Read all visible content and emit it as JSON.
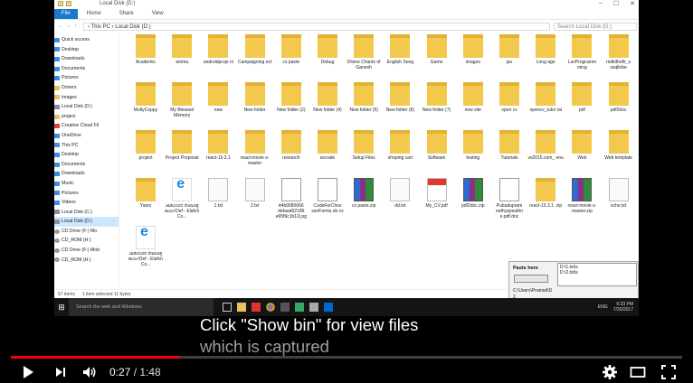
{
  "explorer": {
    "title": "Local Disk (D:)",
    "window_controls": [
      "–",
      "☐",
      "✕"
    ],
    "ribbon_tabs": [
      "File",
      "Home",
      "Share",
      "View"
    ],
    "address": "›  This PC  ›  Local Disk (D:)",
    "search_placeholder": "Search Local Disk (D:)",
    "nav_items": [
      {
        "label": "Quick access",
        "icon": "star-icon"
      },
      {
        "label": "Desktop",
        "icon": "desktop-icon"
      },
      {
        "label": "Downloads",
        "icon": "download-icon"
      },
      {
        "label": "Documents",
        "icon": "documents-icon"
      },
      {
        "label": "Pictures",
        "icon": "pictures-icon"
      },
      {
        "label": "Drivers",
        "icon": "folder-icon"
      },
      {
        "label": "images",
        "icon": "folder-icon"
      },
      {
        "label": "Local Disk (D:)",
        "icon": "drive-icon"
      },
      {
        "label": "project",
        "icon": "folder-icon"
      },
      {
        "label": "Creative Cloud Fil",
        "icon": "creative-cloud-icon"
      },
      {
        "label": "OneDrive",
        "icon": "onedrive-icon"
      },
      {
        "label": "This PC",
        "icon": "pc-icon"
      },
      {
        "label": "Desktop",
        "icon": "desktop-icon"
      },
      {
        "label": "Documents",
        "icon": "documents-icon"
      },
      {
        "label": "Downloads",
        "icon": "download-icon"
      },
      {
        "label": "Music",
        "icon": "music-icon"
      },
      {
        "label": "Pictures",
        "icon": "pictures-icon"
      },
      {
        "label": "Videos",
        "icon": "videos-icon"
      },
      {
        "label": "Local Disk (C:)",
        "icon": "drive-icon"
      },
      {
        "label": "Local Disk (D:)",
        "icon": "drive-icon"
      },
      {
        "label": "CD Drive (F:) Mo",
        "icon": "disc-icon"
      },
      {
        "label": "CD_ROM (H:)",
        "icon": "disc-icon"
      },
      {
        "label": "CD Drive (F:) Mob",
        "icon": "disc-icon"
      },
      {
        "label": "CD_ROM (H:)",
        "icon": "disc-icon"
      }
    ],
    "files": [
      [
        "Academic",
        "amma",
        "androidproje ct",
        "Campaigning ect",
        "cs paste",
        "Debug",
        "Divine Chants of Ganesh",
        "English Song",
        "Game",
        "images",
        "jav",
        "Long age",
        "LuvProgramm ming",
        "mdkithefir_s ssqllobe"
      ],
      [
        "MultyCoppy",
        "My Blessed Memory",
        "new",
        "New folder",
        "New folder (2)",
        "New folder (4)",
        "New folder (5)",
        "New folder (6)",
        "New folder (7)",
        "new site",
        "open cv",
        "opencv_tutor ial",
        "pdf",
        "pdf2doc"
      ],
      [
        "project",
        "Project Proposal",
        "react-15.3.1",
        "react-movie s-master",
        "research",
        "secrate",
        "Setup Files",
        "shoping cart",
        "Software",
        "testing",
        "Tutorials",
        "vs2015.com_ enu",
        "Web",
        "Web template"
      ],
      [
        "Yanni",
        "ಜಾಡಿಯವರ ರೇಖಾಚಿತ್ರ ಕಾರ್ಯDef - Elafcn Co...",
        "1.txt",
        "2.txt",
        "44b9080066 defaad02185 e65f9c1b12j pg",
        "CodeForChos senForms.do cx",
        "cs paste.zip",
        "dd.txt",
        "My_CV.pdf",
        "pdf2doc.zip",
        "Pubudupram eethyayeathn e.pdf.doc",
        "react-15.3.1. zip",
        "react-movie s-master.zip",
        "scho.txt"
      ],
      [
        "ಜಾಡಿಯವರ ರೇಖಾಚಿತ್ರ ಕಾರ್ಯDef - Elafcn Co..."
      ]
    ],
    "status": [
      "57 items",
      "1 item selected  11 bytes"
    ]
  },
  "popup": {
    "label": "Paste here",
    "list": [
      "D:\\1.txt\\s",
      "D:\\2.txt\\s"
    ],
    "path": "C:\\Users\\Pramod\\D",
    "num": "2"
  },
  "taskbar": {
    "search": "Search the web and Windows",
    "time": "6:33 PM",
    "date": "7/30/2017",
    "lang": "ENG"
  },
  "caption": {
    "line1": "Click \"Show bin\" for view files",
    "line2": "which is captured"
  },
  "player": {
    "current_time": "0:27",
    "separator": " / ",
    "duration": "1:48",
    "progress_fraction": 0.25
  }
}
